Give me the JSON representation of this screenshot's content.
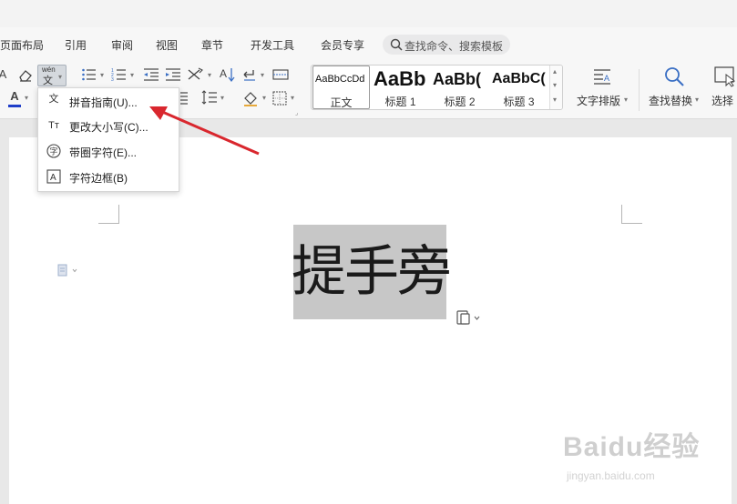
{
  "menubar": {
    "items": [
      "页面布局",
      "引用",
      "审阅",
      "视图",
      "章节",
      "开发工具",
      "会员专享"
    ],
    "search_placeholder": "查找命令、搜索模板"
  },
  "toolbar": {
    "style_gallery": [
      {
        "sample": "AaBbCcDd",
        "name": "正文"
      },
      {
        "sample": "AaBb",
        "name": "标题 1"
      },
      {
        "sample": "AaBb(",
        "name": "标题 2"
      },
      {
        "sample": "AaBbC(",
        "name": "标题 3"
      }
    ],
    "text_layout_label": "文字排版",
    "find_replace_label": "查找替换",
    "select_label": "选择",
    "font_color": "#1f3ec9",
    "pinyin_icon_text": "wén"
  },
  "dropdown": {
    "items": [
      {
        "label": "拼音指南(U)...",
        "icon": "pinyin-guide-icon"
      },
      {
        "label": "更改大小写(C)...",
        "icon": "change-case-icon"
      },
      {
        "label": "带圈字符(E)...",
        "icon": "enclosed-character-icon"
      },
      {
        "label": "字符边框(B)",
        "icon": "character-border-icon"
      }
    ]
  },
  "document": {
    "selected_text": "提手旁"
  },
  "annotation": {
    "arrow_color": "#d9272e"
  },
  "watermark": {
    "logo_text": "Baidu经验",
    "url": "jingyan.baidu.com"
  }
}
